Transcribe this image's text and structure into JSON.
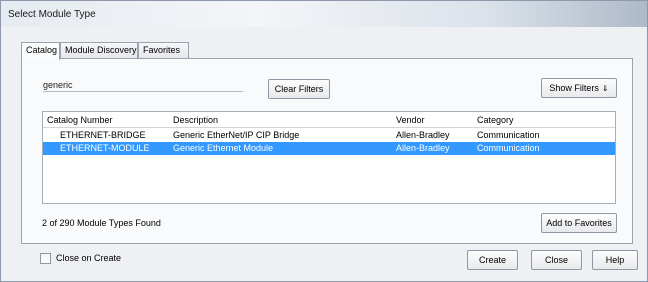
{
  "window": {
    "title": "Select Module Type"
  },
  "tabs": [
    {
      "label": "Catalog",
      "active": true
    },
    {
      "label": "Module Discovery",
      "active": false
    },
    {
      "label": "Favorites",
      "active": false
    }
  ],
  "search": {
    "value": "generic",
    "placeholder": ""
  },
  "buttons": {
    "clear_filters": "Clear Filters",
    "show_filters": "Show Filters",
    "add_to_favorites": "Add to Favorites",
    "create": "Create",
    "close": "Close",
    "help": "Help"
  },
  "table": {
    "columns": [
      "Catalog Number",
      "Description",
      "Vendor",
      "Category"
    ],
    "rows": [
      {
        "catalog": "ETHERNET-BRIDGE",
        "description": "Generic EtherNet/IP CIP Bridge",
        "vendor": "Allen-Bradley",
        "category": "Communication",
        "selected": false
      },
      {
        "catalog": "ETHERNET-MODULE",
        "description": "Generic Ethernet Module",
        "vendor": "Allen-Bradley",
        "category": "Communication",
        "selected": true
      }
    ]
  },
  "status": {
    "count_text": "2 of 290 Module Types Found"
  },
  "options": {
    "close_on_create_label": "Close on Create",
    "close_on_create_checked": false
  },
  "colors": {
    "selection": "#3399ff",
    "window_bg": "#eef0f4"
  },
  "icons": {
    "show_filters": "double-chevron-down-icon"
  }
}
